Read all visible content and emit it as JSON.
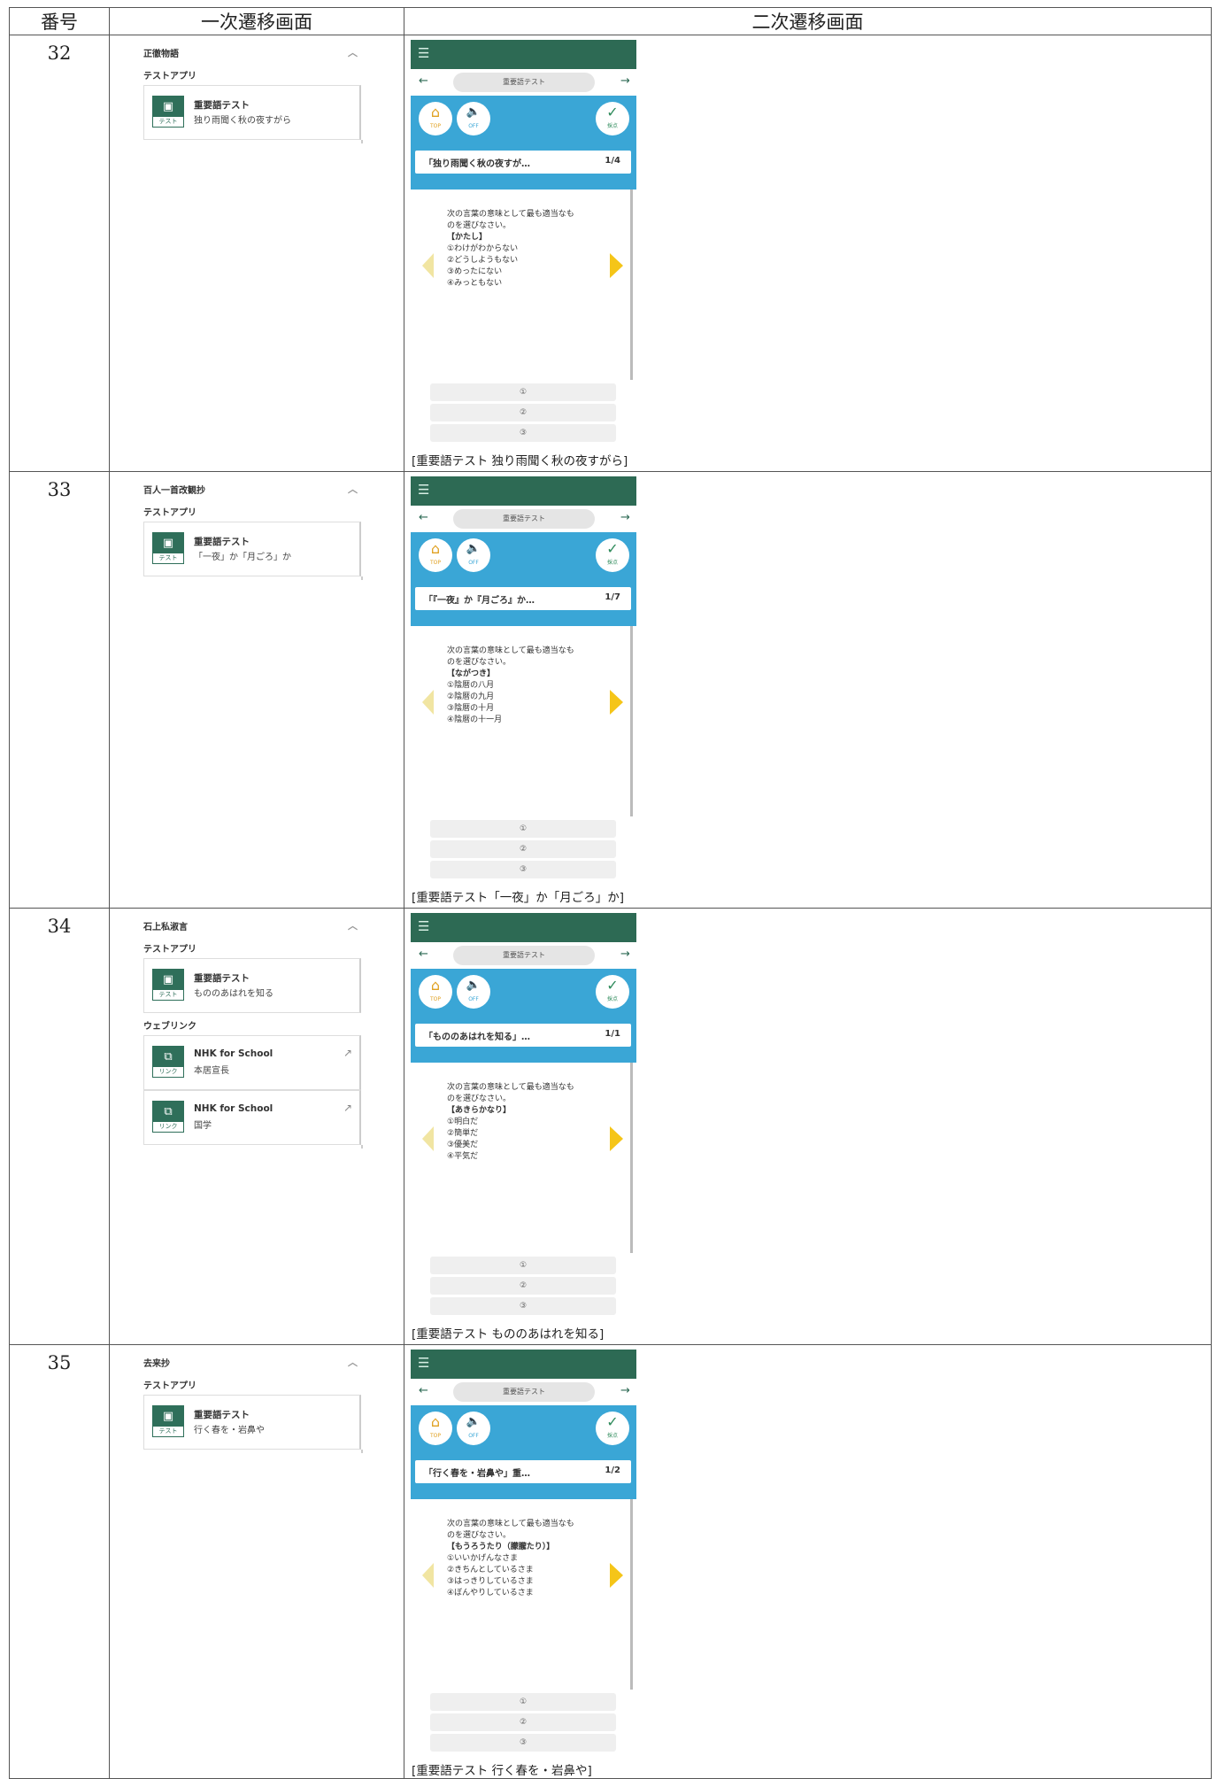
{
  "headers": [
    "番号",
    "一次遷移画面",
    "二次遷移画面"
  ],
  "rows": [
    {
      "num": "32",
      "first": {
        "title": "正徹物語",
        "groups": [
          {
            "label": "テストアプリ",
            "items": [
              {
                "icon": "テスト",
                "title": "重要語テスト",
                "sub": "独り雨聞く秋の夜すがら"
              }
            ]
          }
        ]
      },
      "second": {
        "nav_title": "重要語テスト",
        "btn_top": "TOP",
        "btn_sound": "OFF",
        "btn_score": "採点",
        "qtitle": "「独り雨聞く秋の夜すが…",
        "qnum": "1/4",
        "prompt1": "次の言葉の意味として最も適当なも",
        "prompt2": "のを選びなさい。",
        "keyword": "【かたし】",
        "opts": [
          "①わけがわからない",
          "②どうしようもない",
          "③めったにない",
          "④みっともない"
        ],
        "answers": [
          "①",
          "②",
          "③"
        ],
        "caption": "[重要語テスト 独り雨聞く秋の夜すがら]"
      }
    },
    {
      "num": "33",
      "first": {
        "title": "百人一首改観抄",
        "groups": [
          {
            "label": "テストアプリ",
            "items": [
              {
                "icon": "テスト",
                "title": "重要語テスト",
                "sub": "「一夜」か「月ごろ」か"
              }
            ]
          }
        ]
      },
      "second": {
        "nav_title": "重要語テスト",
        "btn_top": "TOP",
        "btn_sound": "OFF",
        "btn_score": "採点",
        "qtitle": "「『一夜』か『月ごろ』か…",
        "qnum": "1/7",
        "prompt1": "次の言葉の意味として最も適当なも",
        "prompt2": "のを選びなさい。",
        "keyword": "【ながつき】",
        "opts": [
          "①陰暦の八月",
          "②陰暦の九月",
          "③陰暦の十月",
          "④陰暦の十一月"
        ],
        "answers": [
          "①",
          "②",
          "③"
        ],
        "caption": "[重要語テスト「一夜」か「月ごろ」か]"
      }
    },
    {
      "num": "34",
      "first": {
        "title": "石上私淑言",
        "groups": [
          {
            "label": "テストアプリ",
            "items": [
              {
                "icon": "テスト",
                "title": "重要語テスト",
                "sub": "もののあはれを知る"
              }
            ]
          },
          {
            "label": "ウェブリンク",
            "items": [
              {
                "icon": "リンク",
                "title": "NHK for School",
                "sub": "本居宣長",
                "ext": "↗"
              },
              {
                "icon": "リンク",
                "title": "NHK for School",
                "sub": "国学",
                "ext": "↗"
              }
            ]
          }
        ]
      },
      "second": {
        "nav_title": "重要語テスト",
        "btn_top": "TOP",
        "btn_sound": "OFF",
        "btn_score": "採点",
        "qtitle": "「もののあはれを知る」…",
        "qnum": "1/1",
        "prompt1": "次の言葉の意味として最も適当なも",
        "prompt2": "のを選びなさい。",
        "keyword": "【あきらかなり】",
        "opts": [
          "①明白だ",
          "②簡単だ",
          "③優美だ",
          "④平気だ"
        ],
        "answers": [
          "①",
          "②",
          "③"
        ],
        "caption": "[重要語テスト もののあはれを知る]"
      }
    },
    {
      "num": "35",
      "first": {
        "title": "去来抄",
        "groups": [
          {
            "label": "テストアプリ",
            "items": [
              {
                "icon": "テスト",
                "title": "重要語テスト",
                "sub": "行く春を・岩鼻や"
              }
            ]
          }
        ]
      },
      "second": {
        "nav_title": "重要語テスト",
        "btn_top": "TOP",
        "btn_sound": "OFF",
        "btn_score": "採点",
        "qtitle": "「行く春を・岩鼻や」重…",
        "qnum": "1/2",
        "prompt1": "次の言葉の意味として最も適当なも",
        "prompt2": "のを選びなさい。",
        "keyword": "【もうろうたり（朦朧たり）】",
        "opts": [
          "①いいかげんなさま",
          "②きちんとしているさま",
          "③はっきりしているさま",
          "④ぼんやりしているさま"
        ],
        "answers": [
          "①",
          "②",
          "③"
        ],
        "caption": "[重要語テスト 行く春を・岩鼻や]"
      }
    }
  ]
}
